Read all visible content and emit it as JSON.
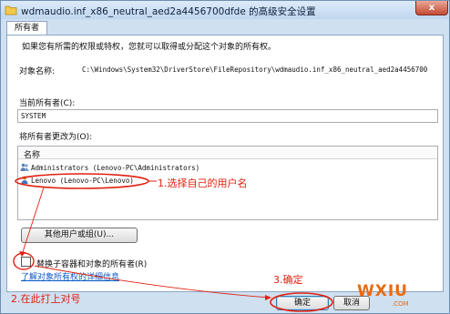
{
  "window": {
    "title": "wdmaudio.inf_x86_neutral_aed2a4456700dfde 的高级安全设置",
    "close_glyph": "x"
  },
  "tab": {
    "label": "所有者"
  },
  "owner": {
    "intro": "如果您有所需的权限或特权，您就可以取得或分配这个对象的所有权。",
    "object_name_label": "对象名称:",
    "object_name_value": "C:\\Windows\\System32\\DriverStore\\FileRepository\\wdmaudio.inf_x86_neutral_aed2a4456700",
    "current_owner_label": "当前所有者(C):",
    "current_owner_value": "SYSTEM",
    "change_to_label": "将所有者更改为(O):",
    "list_header": "名称",
    "list_items": [
      "Administrators (Lenovo-PC\\Administrators)",
      "Lenovo (Lenovo-PC\\Lenovo)"
    ],
    "other_users_button": "其他用户或组(U)...",
    "replace_checkbox_label": "替换子容器和对象的所有者(R)",
    "replace_checkbox_checked": false,
    "learn_more_link": "了解对象所有权的详细信息"
  },
  "buttons": {
    "ok": "确定",
    "cancel": "取消"
  },
  "annotations": {
    "step1": "1.选择自己的用户名",
    "step2": "2.在此打上对号",
    "step3": "3.确定",
    "color": "#e02010"
  },
  "watermark": {
    "brand": "WXIU",
    "suffix": ".COM"
  }
}
